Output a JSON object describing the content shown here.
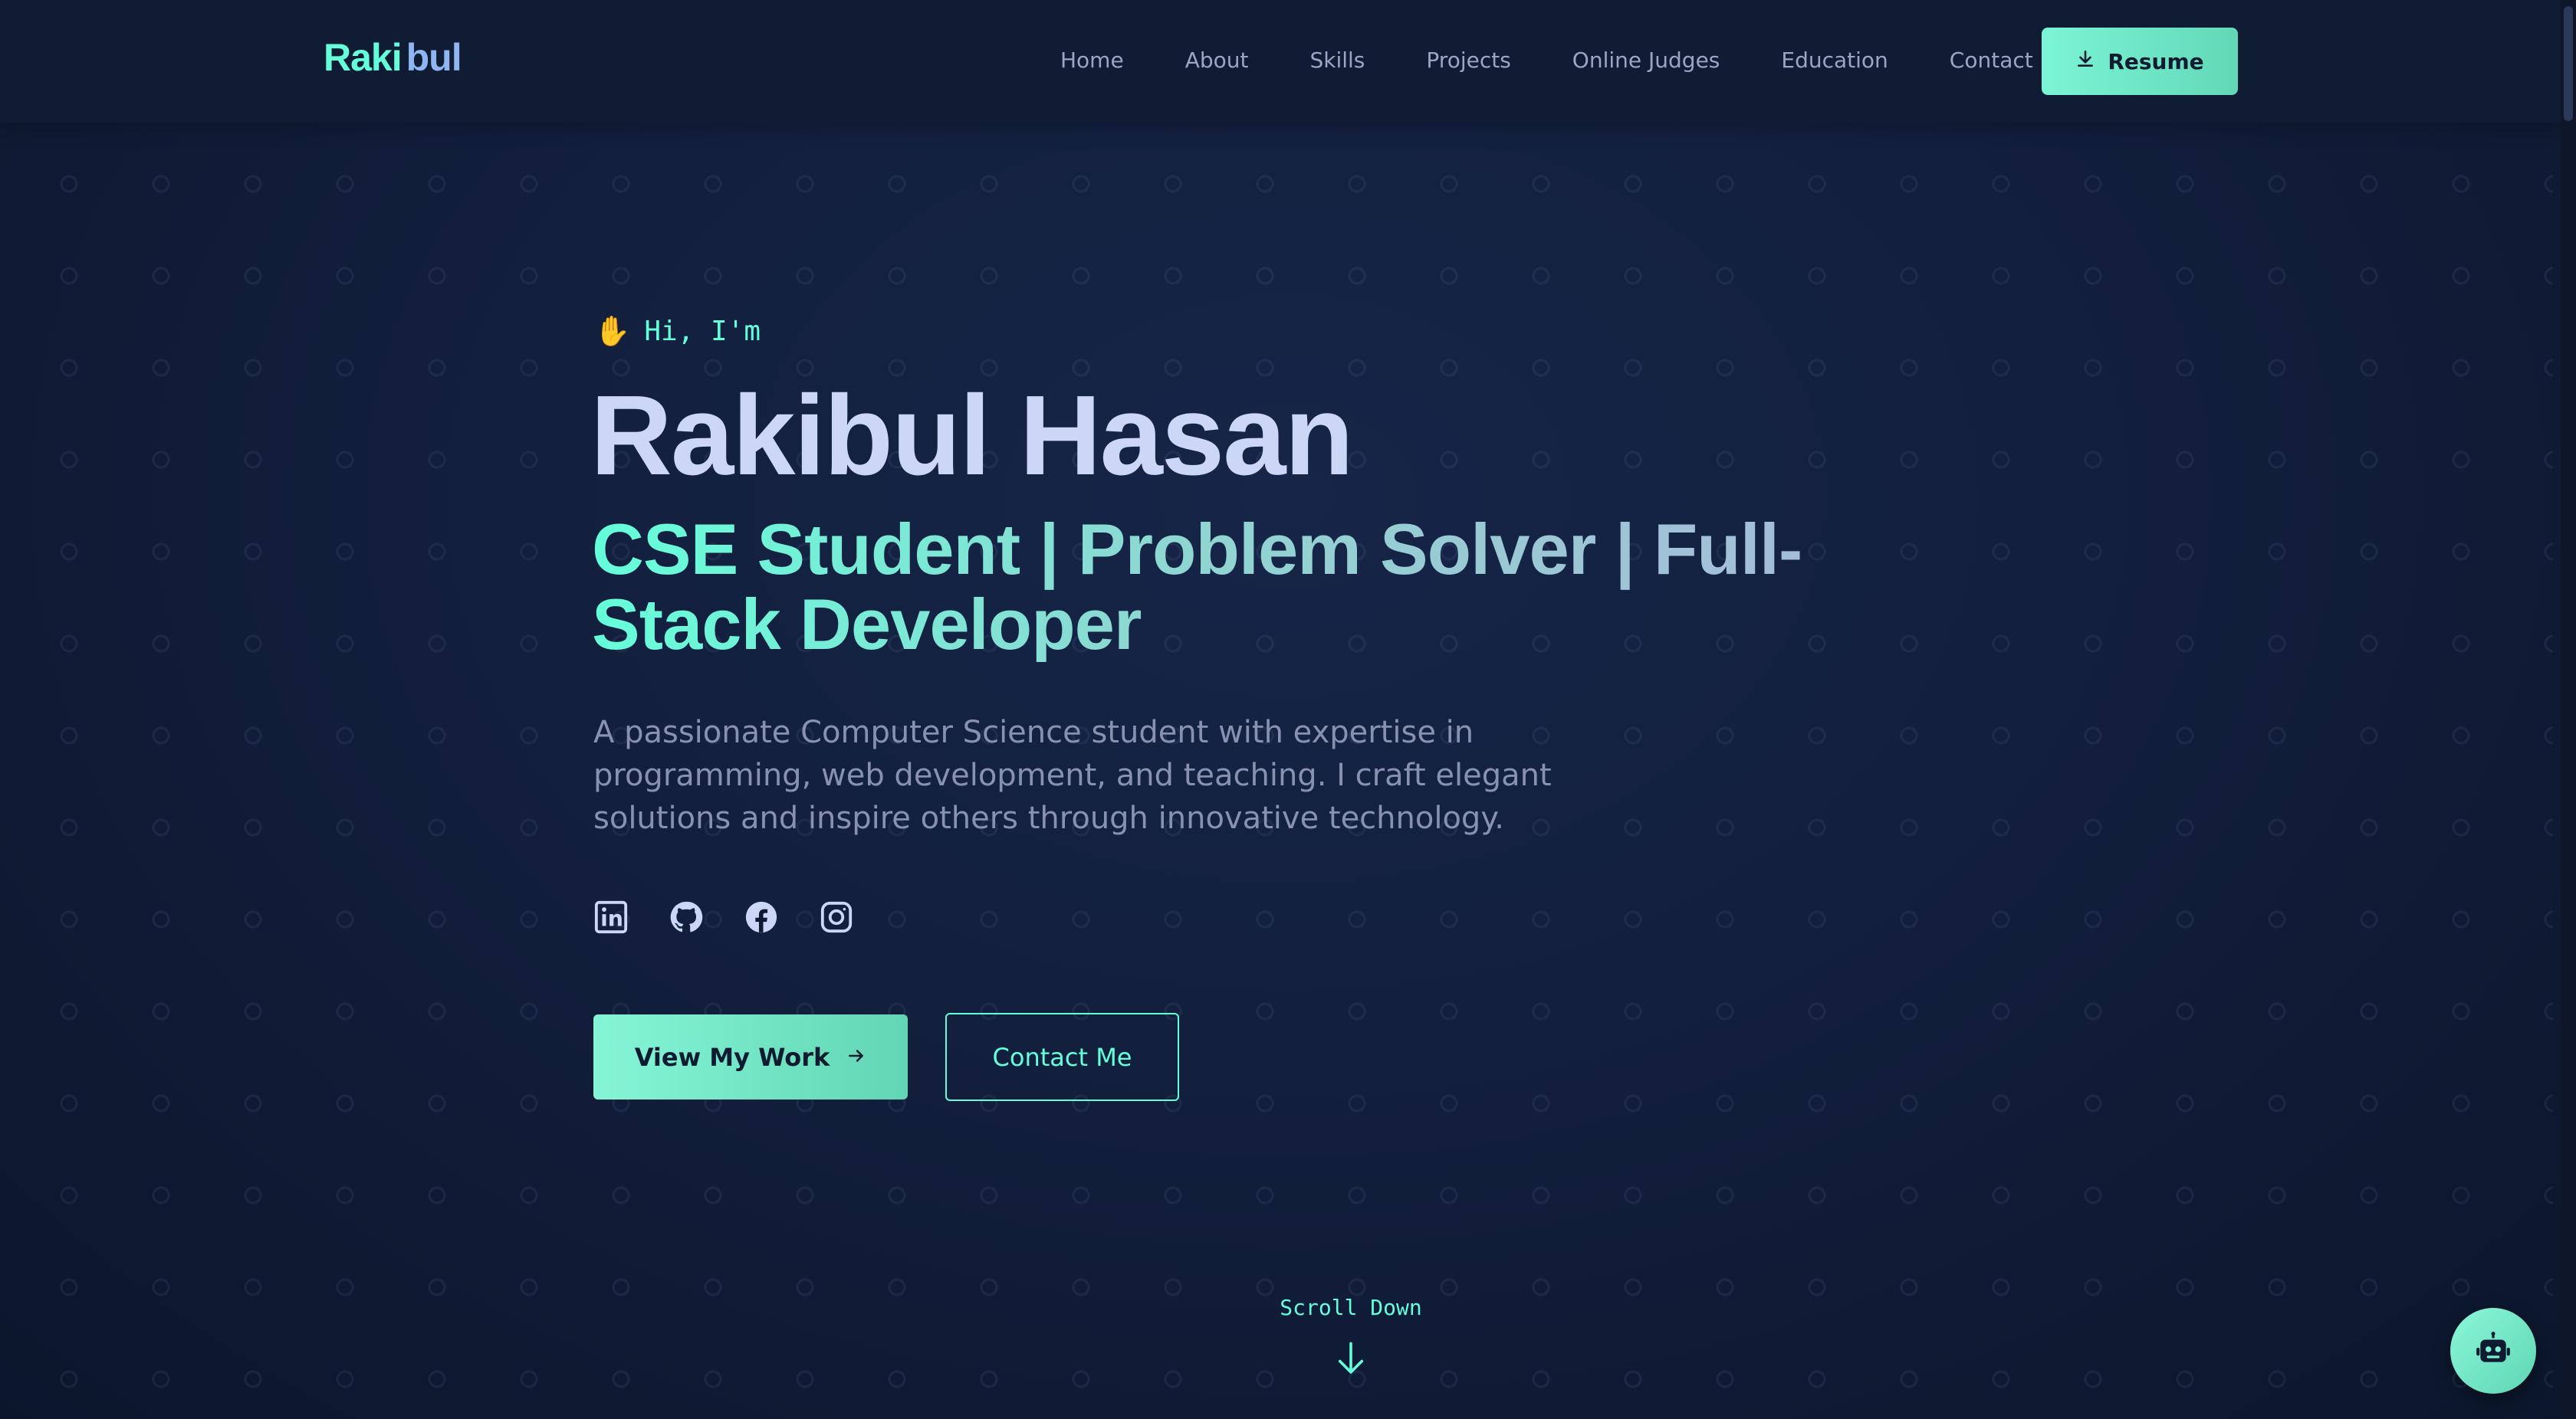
{
  "nav": {
    "logo_part1": "Raki",
    "logo_part2": "bul",
    "links": [
      "Home",
      "About",
      "Skills",
      "Projects",
      "Online Judges",
      "Education",
      "Contact"
    ],
    "resume_label": "Resume"
  },
  "hero": {
    "greeting": "Hi, I'm",
    "greeting_icon": "waving-hand-icon",
    "name": "Rakibul Hasan",
    "role_line1": "CSE Student | Problem Solver | Full-",
    "role_line2": "Stack Developer",
    "description": "A passionate Computer Science student with expertise in programming, web development, and teaching. I craft elegant solutions and inspire others through innovative technology.",
    "socials": [
      "linkedin-icon",
      "github-icon",
      "facebook-icon",
      "instagram-icon"
    ],
    "primary_button": "View My Work",
    "secondary_button": "Contact Me"
  },
  "scroll": {
    "label": "Scroll Down"
  },
  "colors": {
    "accent": "#64ffda",
    "background": "#0f1a30",
    "text_primary": "#ccd6f6",
    "text_muted": "#8892b0"
  }
}
